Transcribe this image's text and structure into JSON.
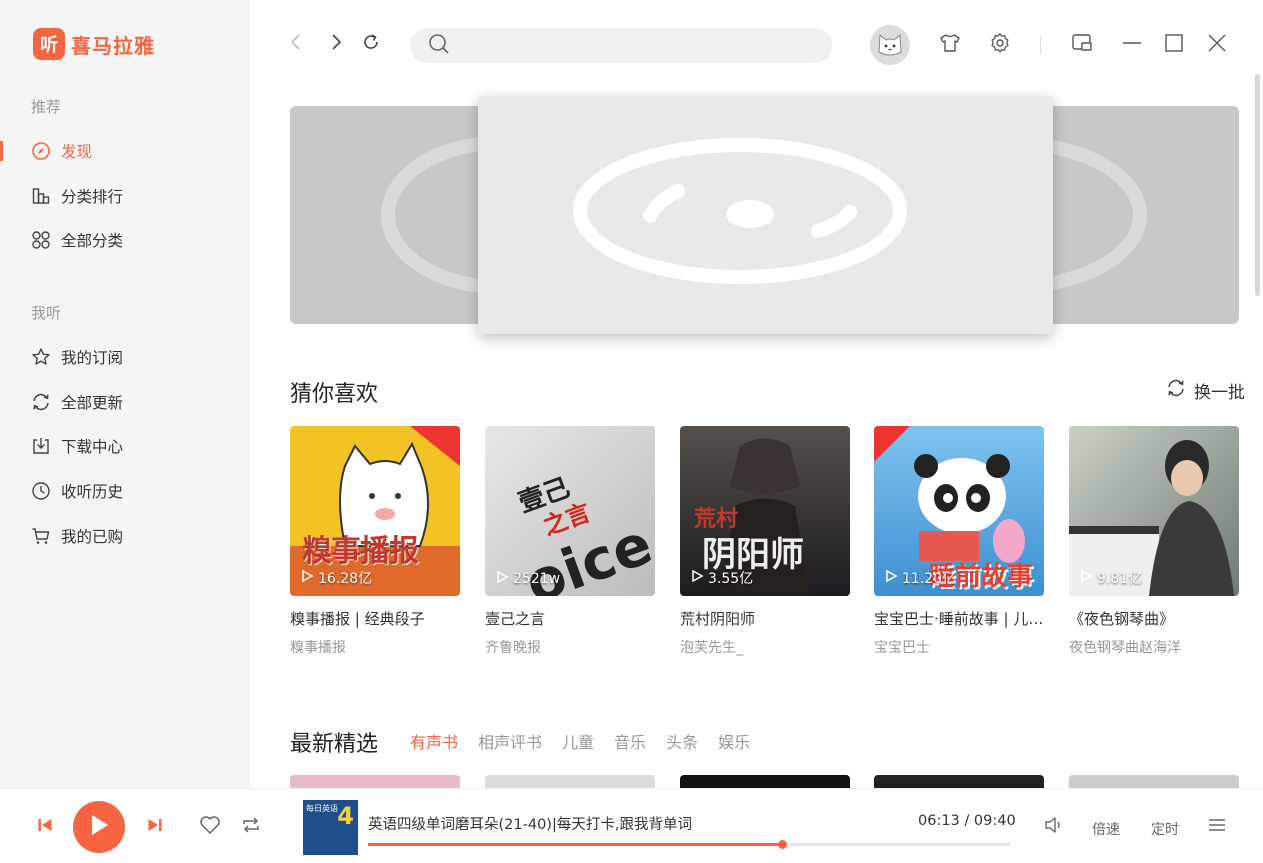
{
  "brand": {
    "logo_glyph": "听",
    "name": "喜马拉雅",
    "color": "#f86442"
  },
  "sidebar": {
    "section_recommend": "推荐",
    "section_mine": "我听",
    "items": [
      {
        "label": "发现",
        "icon": "compass-icon",
        "active": true
      },
      {
        "label": "分类排行",
        "icon": "ranking-icon"
      },
      {
        "label": "全部分类",
        "icon": "grid-icon"
      },
      {
        "label": "我的订阅",
        "icon": "star-icon"
      },
      {
        "label": "全部更新",
        "icon": "refresh-icon"
      },
      {
        "label": "下载中心",
        "icon": "download-icon"
      },
      {
        "label": "收听历史",
        "icon": "clock-icon"
      },
      {
        "label": "我的已购",
        "icon": "cart-icon"
      }
    ]
  },
  "search": {
    "value": "",
    "placeholder": ""
  },
  "guess": {
    "title": "猜你喜欢",
    "refresh_label": "换一批",
    "cards": [
      {
        "title": "糗事播报 | 经典段子",
        "author": "糗事播报",
        "plays": "16.28亿",
        "cover_color": "#f3c325",
        "cover_text": "糗事播报"
      },
      {
        "title": "壹己之言",
        "author": "齐鲁晚报",
        "plays": "2521w",
        "cover_color": "#d9d9d9",
        "cover_text": "壹己之言"
      },
      {
        "title": "荒村阴阳师",
        "author": "泡芙先生_",
        "plays": "3.55亿",
        "cover_color": "#2a2a2e",
        "cover_text": "荒村阴阳师"
      },
      {
        "title": "宝宝巴士·睡前故事 | 儿童故事",
        "author": "宝宝巴士",
        "plays": "11.20亿",
        "cover_color": "#5aa7e0",
        "cover_text": "睡前故事"
      },
      {
        "title": "《夜色钢琴曲》",
        "author": "夜色钢琴曲赵海洋",
        "plays": "9.81亿",
        "cover_color": "#9aa39a",
        "cover_text": ""
      }
    ]
  },
  "latest": {
    "title": "最新精选",
    "tabs": [
      "有声书",
      "相声评书",
      "儿童",
      "音乐",
      "头条",
      "娱乐"
    ],
    "active_tab": 0
  },
  "player": {
    "track_title": "英语四级单词磨耳朵(21-40)|每天打卡,跟我背单词",
    "time": "06:13 / 09:40",
    "progress": 0.645,
    "thumb_text": "每日英语",
    "thumb_num": "4",
    "speed_label": "倍速",
    "timer_label": "定时"
  }
}
